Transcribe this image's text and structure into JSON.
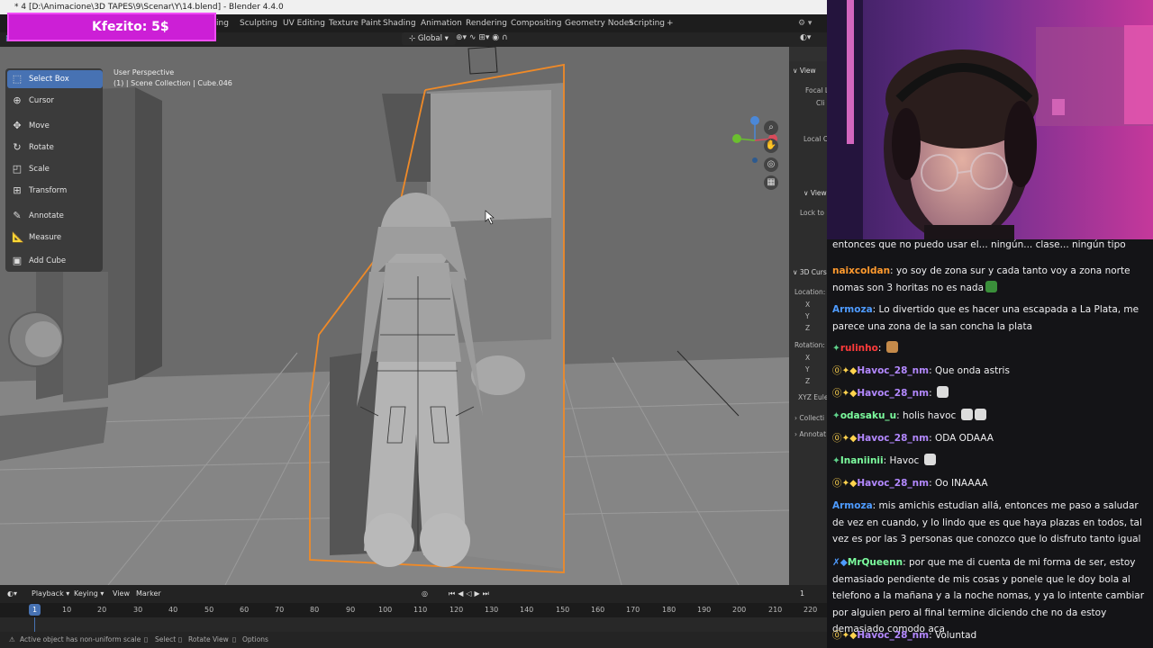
{
  "blender": {
    "title": "* 4 [D:\\Animacione\\3D TAPES\\9\\Scenar\\Y\\14.blend] - Blender 4.4.0",
    "workspace_tabs": [
      "ing",
      "Sculpting",
      "UV Editing",
      "Texture Paint",
      "Shading",
      "Animation",
      "Rendering",
      "Compositing",
      "Geometry Nodes",
      "Scripting",
      "+"
    ],
    "orientation": "Global",
    "viewport_info": {
      "perspective": "User Perspective",
      "collection": "(1) | Scene Collection | Cube.046"
    },
    "tools": [
      "Select Box",
      "Cursor",
      "Move",
      "Rotate",
      "Scale",
      "Transform",
      "Annotate",
      "Measure",
      "Add Cube"
    ],
    "tool_icons": [
      "select-box-icon",
      "cursor-icon",
      "move-icon",
      "rotate-icon",
      "scale-icon",
      "transform-icon",
      "annotate-icon",
      "measure-icon",
      "add-cube-icon"
    ],
    "n_panel": {
      "view_header": "View",
      "focal": "Focal L",
      "clip": "Cli",
      "local_camera": "Local C",
      "view_sub": "View",
      "lock_to": "Lock to",
      "cursor_header": "3D Curs",
      "location": "Location:",
      "x": "X",
      "y": "Y",
      "z": "Z",
      "rotation": "Rotation:",
      "rx": "X",
      "ry": "Y",
      "rz": "Z",
      "euler": "XYZ Eule",
      "collection": "Collecti",
      "annotation": "Annotat"
    },
    "timeline": {
      "menus": [
        "Playback",
        "Keying",
        "View",
        "Marker"
      ],
      "current_frame": "1",
      "frame_display": "1",
      "ticks": [
        "10",
        "20",
        "30",
        "40",
        "50",
        "60",
        "70",
        "80",
        "90",
        "100",
        "110",
        "120",
        "130",
        "140",
        "150",
        "160",
        "170",
        "180",
        "190",
        "200",
        "210",
        "220"
      ]
    },
    "status": {
      "warning": "Active object has non-uniform scale",
      "select": "Select",
      "rotate": "Rotate View",
      "options": "Options"
    }
  },
  "donation": {
    "text": "Kfezito: 5$"
  },
  "chat": {
    "messages": [
      {
        "user": "",
        "text": "entonces que no puedo usar el... ningún... clase... ningún tipo ahora mismo",
        "color": "#efeff1",
        "badges": ""
      },
      {
        "user": "naixcoldan",
        "text": "yo soy de zona sur y cada tanto voy a zona norte nomas son 3 horitas no es nada",
        "color": "#ff9a2e",
        "badges": ""
      },
      {
        "user": "Armoza",
        "text": "Lo divertido que es hacer una escapada a La Plata, me parece una zona de la san concha la plata",
        "color": "#4e9bff",
        "badges": ""
      },
      {
        "user": "rulinho",
        "text": "",
        "color": "#ff3b3b",
        "badges": "✦"
      },
      {
        "user": "Havoc_28_nm",
        "text": "Que onda astris",
        "color": "#b388ff",
        "badges": "⓪✦◆"
      },
      {
        "user": "Havoc_28_nm",
        "text": "",
        "color": "#b388ff",
        "badges": "⓪✦◆"
      },
      {
        "user": "odasaku_u",
        "text": "holis havoc",
        "color": "#7cfc9e",
        "badges": "✦"
      },
      {
        "user": "Havoc_28_nm",
        "text": "ODA ODAAA",
        "color": "#b388ff",
        "badges": "⓪✦◆"
      },
      {
        "user": "Inaniinii",
        "text": "Havoc",
        "color": "#7cfc9e",
        "badges": "✦"
      },
      {
        "user": "Havoc_28_nm",
        "text": "Oo INAAAA",
        "color": "#b388ff",
        "badges": "⓪✦◆"
      },
      {
        "user": "Armoza",
        "text": "mis amichis estudian allá, entonces me paso a saludar de vez en cuando, y lo lindo que es que haya plazas en todos, tal vez es por las 3 personas que conozco que lo disfruto tanto igual",
        "color": "#4e9bff",
        "badges": ""
      },
      {
        "user": "MrQueenn",
        "text": "por que me di cuenta de mi forma de ser, estoy demasiado pendiente de mis cosas y ponele que le doy bola al telefono a la mañana y a la noche nomas, y ya lo intente cambiar por alguien pero al final termine diciendo che no da estoy demasiado comodo aca",
        "color": "#7cfc9e",
        "badges": "✗◆"
      },
      {
        "user": "Havoc_28_nm",
        "text": "Voluntad",
        "color": "#b388ff",
        "badges": "⓪✦◆"
      }
    ]
  }
}
